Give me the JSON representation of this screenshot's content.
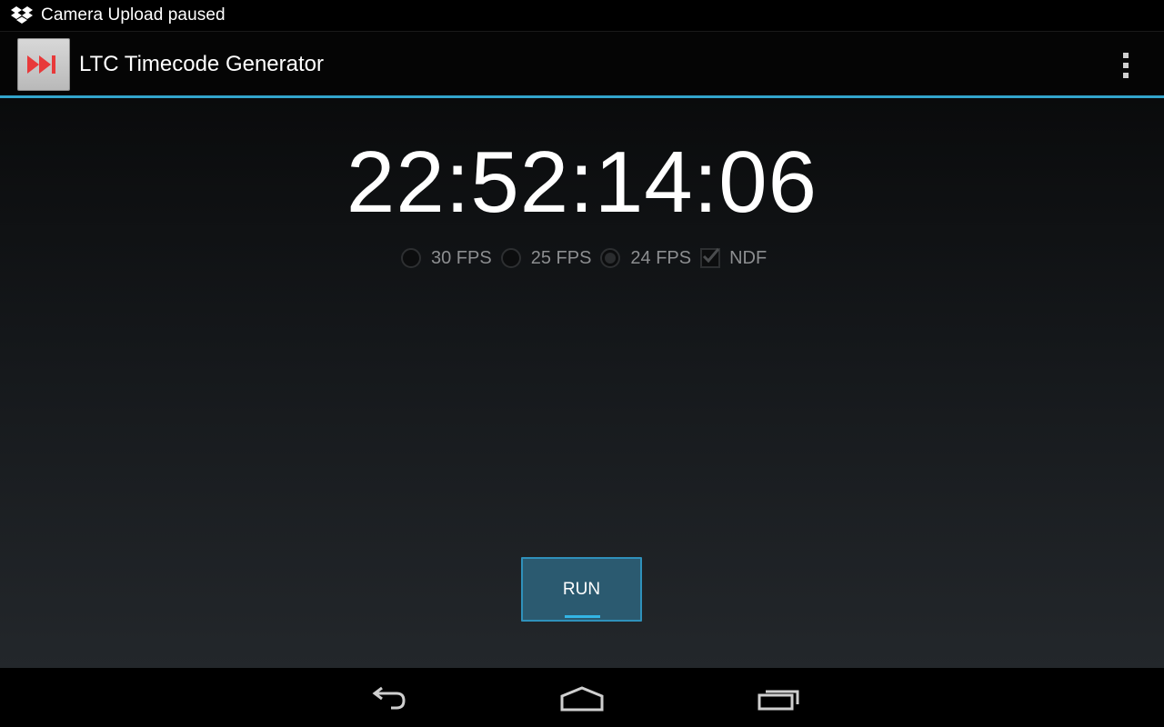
{
  "status_bar": {
    "notification_text": "Camera Upload paused",
    "notification_icon": "dropbox-icon"
  },
  "action_bar": {
    "title": "LTC Timecode Generator",
    "app_icon": "fast-forward-icon",
    "overflow_icon": "overflow-menu-icon",
    "accent_color": "#33a5cc"
  },
  "main": {
    "timecode": "22:52:14:06",
    "fps_options": [
      {
        "label": "30 FPS",
        "selected": false
      },
      {
        "label": "25 FPS",
        "selected": false
      },
      {
        "label": "24 FPS",
        "selected": true
      }
    ],
    "ndf": {
      "label": "NDF",
      "checked": true
    },
    "run_label": "RUN",
    "run_color": "#2b5a70"
  },
  "nav_bar": {
    "back_icon": "back-icon",
    "home_icon": "home-icon",
    "recents_icon": "recent-apps-icon"
  }
}
